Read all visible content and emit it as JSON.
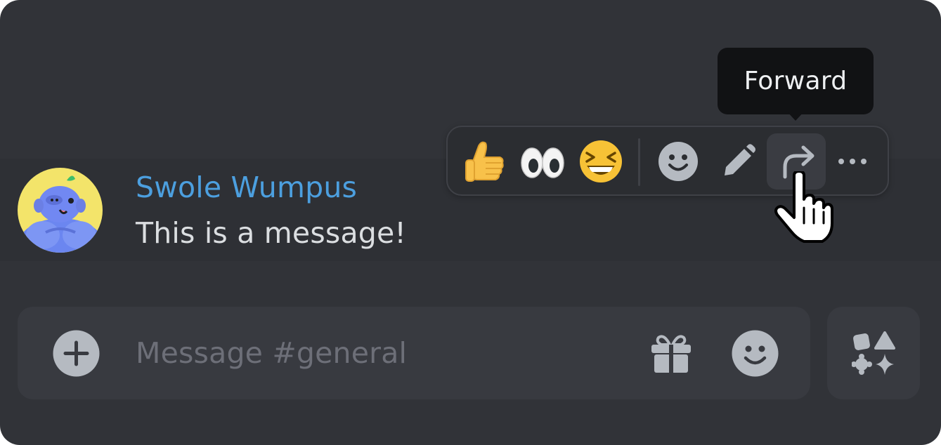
{
  "message": {
    "username": "Swole Wumpus",
    "text": "This is a message!",
    "username_color": "#4c9fdf"
  },
  "toolbar": {
    "reactions": [
      {
        "name": "thumbs-up",
        "glyph": "👍"
      },
      {
        "name": "eyes",
        "glyph": "👀"
      },
      {
        "name": "laughing",
        "glyph": "😆"
      }
    ],
    "actions": [
      "add-reaction-icon",
      "edit-icon",
      "forward-icon",
      "more-icon"
    ],
    "active_action": "forward"
  },
  "tooltip": {
    "label": "Forward"
  },
  "composer": {
    "placeholder": "Message #general"
  },
  "colors": {
    "background": "#313338",
    "message_hover": "#2e3035",
    "composer": "#383a40",
    "icon": "#b5bac1",
    "tooltip": "#111214"
  }
}
